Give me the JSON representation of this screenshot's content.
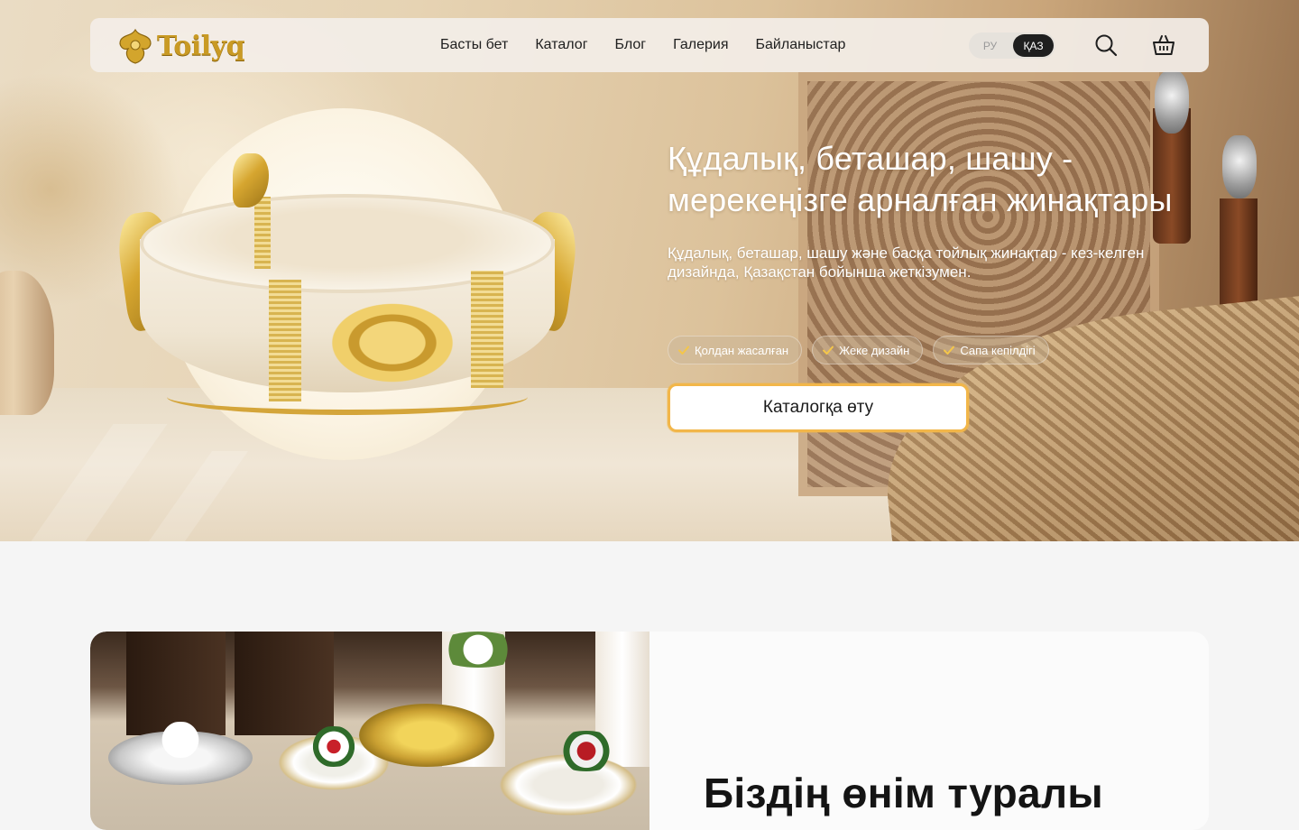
{
  "brand": {
    "name": "Toilyq"
  },
  "nav": {
    "items": [
      {
        "label": "Басты бет"
      },
      {
        "label": "Каталог"
      },
      {
        "label": "Блог"
      },
      {
        "label": "Галерия"
      },
      {
        "label": "Байланыстар"
      }
    ]
  },
  "language": {
    "options": [
      "РУ",
      "ҚАЗ"
    ],
    "selected": "ҚАЗ"
  },
  "header_icons": {
    "search": "search-icon",
    "cart": "basket-icon"
  },
  "hero": {
    "title": "Құдалық, беташар, шашу - мерекеңізге арналған жинақтары",
    "subtitle": "Құдалық, беташар, шашу және басқа тойлық жинақтар - кез-келген дизайнда, Қазақстан бойынша жеткізумен.",
    "badges": [
      "Қолдан жасалған",
      "Жеке дизайн",
      "Сапа кепілдігі"
    ],
    "cta_label": "Каталогқа өту"
  },
  "about": {
    "title": "Біздің өнім туралы"
  },
  "colors": {
    "accent": "#f2b649",
    "brand_gold": "#c99a24",
    "dark": "#1f1f1f",
    "page_bg": "#f5f5f5"
  }
}
